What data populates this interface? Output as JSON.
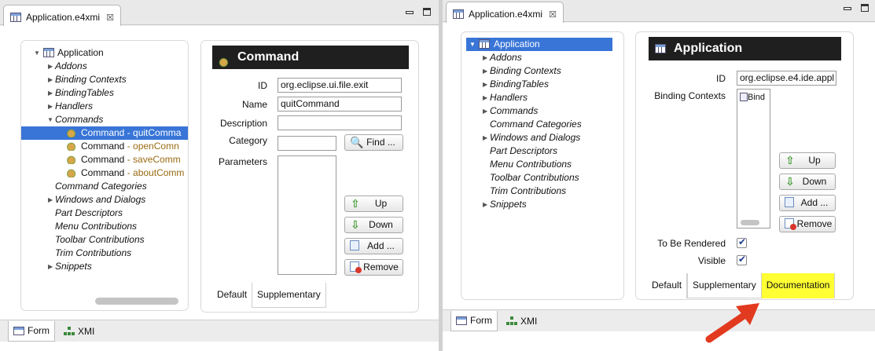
{
  "left": {
    "tab_title": "Application.e4xmi",
    "tree": [
      {
        "label": "Application",
        "italic": false
      },
      {
        "label": "Addons"
      },
      {
        "label": "Binding Contexts"
      },
      {
        "label": "BindingTables"
      },
      {
        "label": "Handlers"
      },
      {
        "label": "Commands"
      },
      {
        "label": "Command",
        "desc": "- quitComma"
      },
      {
        "label": "Command",
        "desc": "- openComn"
      },
      {
        "label": "Command",
        "desc": "- saveComm"
      },
      {
        "label": "Command",
        "desc": "- aboutComm"
      },
      {
        "label": "Command Categories"
      },
      {
        "label": "Windows and Dialogs"
      },
      {
        "label": "Part Descriptors"
      },
      {
        "label": "Menu Contributions"
      },
      {
        "label": "Toolbar Contributions"
      },
      {
        "label": "Trim Contributions"
      },
      {
        "label": "Snippets"
      }
    ],
    "detail_title": "Command",
    "id_label": "ID",
    "id_value": "org.eclipse.ui.file.exit",
    "name_label": "Name",
    "name_value": "quitCommand",
    "description_label": "Description",
    "description_value": "",
    "category_label": "Category",
    "category_value": "",
    "find_label": "Find ...",
    "parameters_label": "Parameters",
    "up_label": "Up",
    "down_label": "Down",
    "add_label": "Add ...",
    "remove_label": "Remove",
    "tab_default": "Default",
    "tab_supplementary": "Supplementary",
    "bottom_form": "Form",
    "bottom_xmi": "XMI"
  },
  "right": {
    "tab_title": "Application.e4xmi",
    "tree": [
      {
        "label": "Application"
      },
      {
        "label": "Addons"
      },
      {
        "label": "Binding Contexts"
      },
      {
        "label": "BindingTables"
      },
      {
        "label": "Handlers"
      },
      {
        "label": "Commands"
      },
      {
        "label": "Command Categories"
      },
      {
        "label": "Windows and Dialogs"
      },
      {
        "label": "Part Descriptors"
      },
      {
        "label": "Menu Contributions"
      },
      {
        "label": "Toolbar Contributions"
      },
      {
        "label": "Trim Contributions"
      },
      {
        "label": "Snippets"
      }
    ],
    "detail_title": "Application",
    "id_label": "ID",
    "id_value": "org.eclipse.e4.ide.appl",
    "binding_contexts_label": "Binding Contexts",
    "binding_item": "Bind",
    "up_label": "Up",
    "down_label": "Down",
    "add_label": "Add ...",
    "remove_label": "Remove",
    "to_be_rendered_label": "To Be Rendered",
    "visible_label": "Visible",
    "tab_default": "Default",
    "tab_supplementary": "Supplementary",
    "tab_documentation": "Documentation",
    "bottom_form": "Form",
    "bottom_xmi": "XMI"
  },
  "colors": {
    "selection": "#3875d7",
    "highlight": "#ffff33",
    "annotation_arrow": "#e23a1f"
  }
}
